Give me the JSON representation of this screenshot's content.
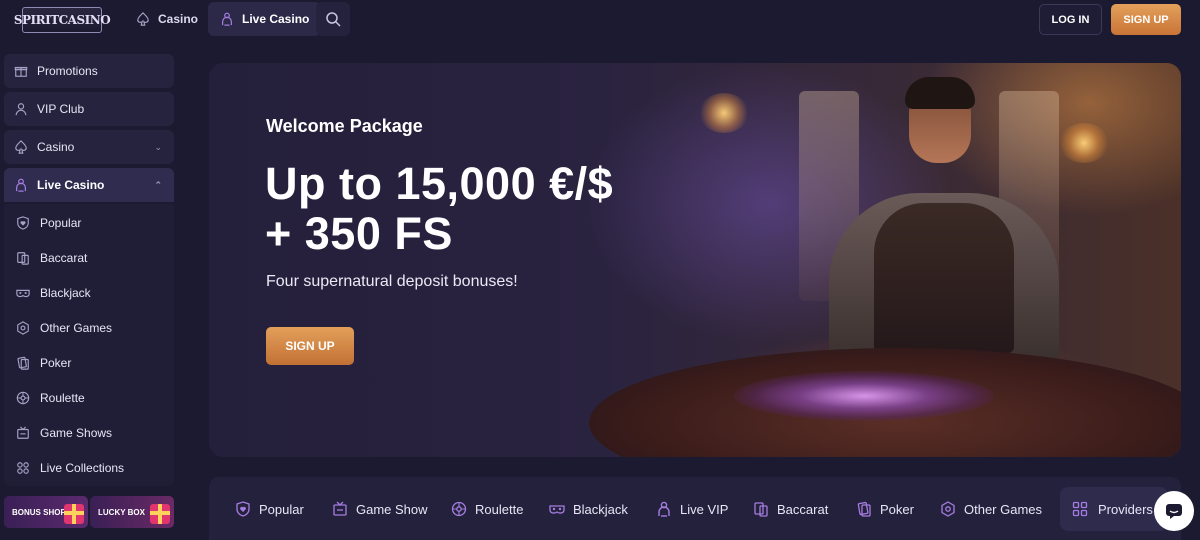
{
  "header": {
    "logo_text": "SPIRITCASINO",
    "nav": [
      {
        "label": "Casino",
        "icon": "spade-icon"
      },
      {
        "label": "Live Casino",
        "icon": "dealer-icon"
      }
    ],
    "search_icon": "search-icon",
    "login_label": "LOG IN",
    "signup_label": "SIGN UP"
  },
  "sidebar": {
    "items": [
      {
        "label": "Promotions",
        "icon": "gift-icon"
      },
      {
        "label": "VIP Club",
        "icon": "user-icon"
      },
      {
        "label": "Casino",
        "icon": "spade-icon",
        "expanded": false
      },
      {
        "label": "Live Casino",
        "icon": "dealer-icon",
        "expanded": true
      }
    ],
    "live_casino_items": [
      {
        "label": "Popular",
        "icon": "shield-heart-icon"
      },
      {
        "label": "Baccarat",
        "icon": "cards-icon"
      },
      {
        "label": "Blackjack",
        "icon": "mask-icon"
      },
      {
        "label": "Other Games",
        "icon": "hexagon-icon"
      },
      {
        "label": "Poker",
        "icon": "poker-cards-icon"
      },
      {
        "label": "Roulette",
        "icon": "roulette-icon"
      },
      {
        "label": "Game Shows",
        "icon": "tv-icon"
      },
      {
        "label": "Live Collections",
        "icon": "grid-icon"
      }
    ],
    "tiles": [
      {
        "label": "BONUS SHOP"
      },
      {
        "label": "LUCKY BOX"
      }
    ]
  },
  "hero": {
    "kicker": "Welcome Package",
    "headline_line1": "Up to 15,000 €/$",
    "headline_line2": "+ 350 FS",
    "subtitle": "Four supernatural deposit bonuses!",
    "cta_label": "SIGN UP"
  },
  "categories": [
    {
      "label": "Popular",
      "icon": "shield-heart-icon"
    },
    {
      "label": "Game Show",
      "icon": "tv-icon"
    },
    {
      "label": "Roulette",
      "icon": "roulette-icon"
    },
    {
      "label": "Blackjack",
      "icon": "mask-icon"
    },
    {
      "label": "Live VIP",
      "icon": "dealer-icon"
    },
    {
      "label": "Baccarat",
      "icon": "cards-icon"
    },
    {
      "label": "Poker",
      "icon": "poker-cards-icon"
    },
    {
      "label": "Other Games",
      "icon": "hexagon-icon"
    }
  ],
  "providers_label": "Providers",
  "chat_icon": "chat-icon",
  "colors": {
    "background": "#1c1a31",
    "accent_orange": "#d98a47",
    "category_icon_purple": "#a57de0"
  }
}
